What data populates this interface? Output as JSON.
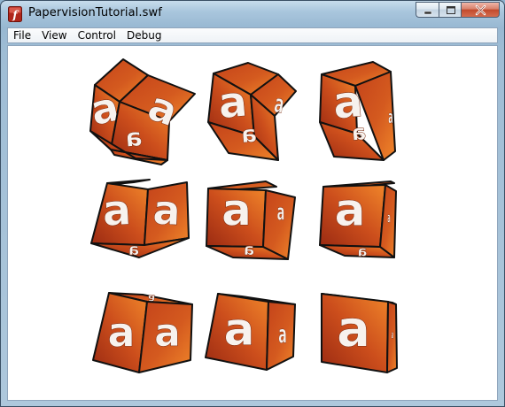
{
  "window": {
    "title": "PapervisionTutorial.swf",
    "icon": "flash-player-icon",
    "caption_buttons": [
      "minimize",
      "maximize",
      "close"
    ]
  },
  "menu": {
    "items": [
      "File",
      "View",
      "Control",
      "Debug"
    ]
  },
  "stage": {
    "background": "#ffffff",
    "cube_face_color": "#c4431a",
    "cube_face_highlight": "#f0862a",
    "cube_edge_color": "#111111",
    "cube_letter": "a",
    "cube_count": 9
  }
}
